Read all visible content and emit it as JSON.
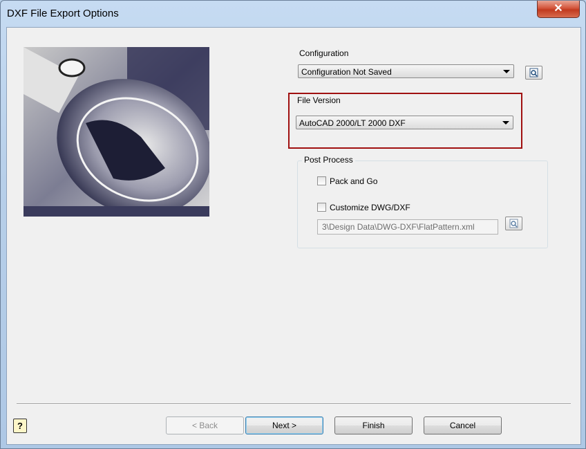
{
  "window": {
    "title": "DXF File Export Options",
    "close_glyph": "✕"
  },
  "configuration": {
    "label": "Configuration",
    "selected": "Configuration Not Saved"
  },
  "file_version": {
    "label": "File Version",
    "selected": "AutoCAD 2000/LT 2000 DXF"
  },
  "post_process": {
    "label": "Post Process",
    "pack_and_go": {
      "label": "Pack and Go",
      "checked": false
    },
    "customize": {
      "label": "Customize DWG/DXF",
      "checked": false
    },
    "path_value": "3\\Design Data\\DWG-DXF\\FlatPattern.xml"
  },
  "buttons": {
    "help": "?",
    "back": "< Back",
    "next": "Next >",
    "finish": "Finish",
    "cancel": "Cancel"
  },
  "icons": {
    "browse": "browse-icon",
    "help": "help-icon",
    "preview": "model-preview-image"
  }
}
